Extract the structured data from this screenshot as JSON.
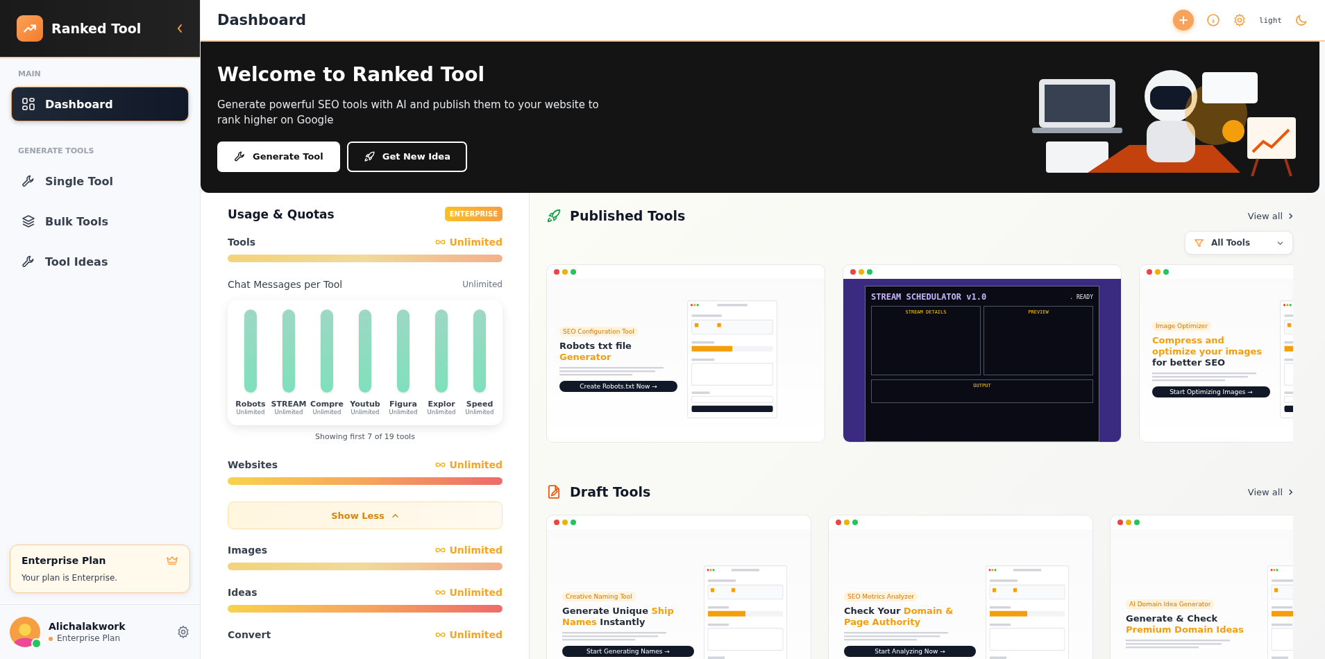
{
  "sidebar": {
    "brand": "Ranked Tool",
    "sections": [
      {
        "heading": "MAIN",
        "items": [
          {
            "label": "Dashboard",
            "selected": true
          }
        ]
      },
      {
        "heading": "GENERATE TOOLS",
        "items": [
          {
            "label": "Single Tool",
            "selected": false
          },
          {
            "label": "Bulk Tools",
            "selected": false
          },
          {
            "label": "Tool Ideas",
            "selected": false
          }
        ]
      }
    ],
    "plan_card": {
      "title": "Enterprise Plan",
      "text": "Your plan is Enterprise."
    },
    "user": {
      "name": "Alichalakwork",
      "plan": "Enterprise Plan",
      "online": true
    }
  },
  "header": {
    "title": "Dashboard",
    "theme_label": "light"
  },
  "banner": {
    "title": "Welcome to Ranked Tool",
    "text": "Generate powerful SEO tools with AI and publish them to your website to rank higher on Google",
    "buttons": [
      {
        "label": "Generate Tool",
        "kind": "primary"
      },
      {
        "label": "Get New Idea",
        "kind": "outline"
      }
    ]
  },
  "usage": {
    "title": "Usage & Quotas",
    "badge": "ENTERPRISE",
    "quotas": [
      {
        "label": "Tools",
        "value": "Unlimited",
        "level": 1
      },
      {
        "label": "Chat Messages per Tool",
        "value": "Unlimited",
        "kind": "per_tool",
        "tools": [
          {
            "name": "Robots",
            "value": "Unlimited",
            "level": 1
          },
          {
            "name": "STREAM",
            "value": "Unlimited",
            "level": 1
          },
          {
            "name": "Compre",
            "value": "Unlimited",
            "level": 1
          },
          {
            "name": "Youtub",
            "value": "Unlimited",
            "level": 1
          },
          {
            "name": "Figura",
            "value": "Unlimited",
            "level": 1
          },
          {
            "name": "Explor",
            "value": "Unlimited",
            "level": 1
          },
          {
            "name": "Speed",
            "value": "Unlimited",
            "level": 1
          }
        ],
        "note": "Showing first 7 of 19 tools"
      },
      {
        "label": "Websites",
        "value": "Unlimited",
        "level": 1
      },
      {
        "kind": "toggle",
        "label": "Show Less",
        "expanded": true
      },
      {
        "label": "Images",
        "value": "Unlimited",
        "level": 1
      },
      {
        "label": "Ideas",
        "value": "Unlimited",
        "level": 1
      },
      {
        "label": "Convert",
        "value": "Unlimited"
      }
    ]
  },
  "published": {
    "title": "Published Tools",
    "view_all": "View all",
    "filter": "All Tools",
    "cards": [
      {
        "kind": "light",
        "badge": "SEO Configuration Tool",
        "title": [
          {
            "text": "Robots txt file ",
            "accent": false
          },
          {
            "text": "Generator",
            "accent": true
          }
        ],
        "cta": "Create Robots.txt Now →"
      },
      {
        "kind": "dark",
        "title": "STREAM SCHEDULATOR v1.0",
        "status": ". READY",
        "panels": [
          "STREAM DETAILS",
          "PREVIEW"
        ],
        "output": "OUTPUT"
      },
      {
        "kind": "light",
        "badge": "Image Optimizer",
        "title": [
          {
            "text": "Compress and optimize your images ",
            "accent": true
          },
          {
            "text": "for better SEO",
            "accent": false
          }
        ],
        "cta": "Start Optimizing Images →"
      }
    ]
  },
  "drafts": {
    "title": "Draft Tools",
    "view_all": "View all",
    "cards": [
      {
        "kind": "light",
        "badge": "Creative Naming Tool",
        "title": [
          {
            "text": "Generate Unique ",
            "accent": false
          },
          {
            "text": "Ship Names",
            "accent": true
          },
          {
            "text": " Instantly",
            "accent": false
          }
        ],
        "cta": "Start Generating Names →"
      },
      {
        "kind": "light",
        "badge": "SEO Metrics Analyzer",
        "title": [
          {
            "text": "Check Your ",
            "accent": false
          },
          {
            "text": "Domain & Page Authority",
            "accent": true
          }
        ],
        "cta": "Start Analyzing Now →"
      },
      {
        "kind": "light",
        "badge": "AI Domain Idea Generator",
        "title": [
          {
            "text": "Generate & Check ",
            "accent": false
          },
          {
            "text": "Premium Domain Ideas",
            "accent": true
          }
        ]
      }
    ]
  }
}
